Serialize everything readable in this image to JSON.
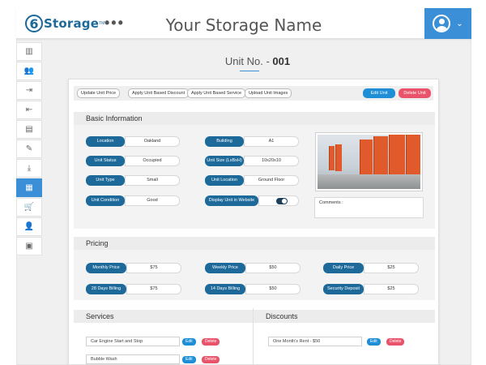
{
  "header": {
    "logo_prefix": "6",
    "logo_text": "Storage",
    "logo_tm": "TM",
    "more": "•••",
    "storage_name": "Your Storage Name",
    "accent_color": "#3a8fd6",
    "brand_color": "#1d6a9a"
  },
  "sidebar": {
    "items": [
      {
        "icon": "bar-chart-icon"
      },
      {
        "icon": "users-icon"
      },
      {
        "icon": "move-in-icon"
      },
      {
        "icon": "move-out-icon"
      },
      {
        "icon": "clipboard-icon"
      },
      {
        "icon": "edit-document-icon"
      },
      {
        "icon": "hand-money-icon"
      },
      {
        "icon": "storage-unit-icon",
        "active": true
      },
      {
        "icon": "cart-icon"
      },
      {
        "icon": "user-settings-icon"
      },
      {
        "icon": "report-icon"
      }
    ]
  },
  "page": {
    "title_prefix": "Unit No. -",
    "unit_number": "001"
  },
  "toolbar": {
    "update_price": "Update Unit Price",
    "apply_discount": "Apply Unit Based Discount",
    "apply_service": "Apply Unit Based Service",
    "upload_images": "Upload Unit Images",
    "edit_unit": "Edit Unit",
    "delete_unit": "Delete Unit"
  },
  "basic_info": {
    "heading": "Basic Information",
    "location_label": "Location",
    "location_value": "Oakland",
    "building_label": "Building",
    "building_value": "A1",
    "status_label": "Unit Status",
    "status_value": "Occupied",
    "size_label": "Unit Size (LxBxH)",
    "size_value": "10x20x10",
    "type_label": "Unit Type",
    "type_value": "Small",
    "unit_location_label": "Unit Location",
    "unit_location_value": "Ground Floor",
    "condition_label": "Unit Condition",
    "condition_value": "Good",
    "display_label": "Display Unit in Website",
    "display_on": true,
    "comments_label": "Comments :"
  },
  "pricing": {
    "heading": "Pricing",
    "monthly_label": "Monthly Price",
    "monthly_value": "$75",
    "weekly_label": "Weekly Price",
    "weekly_value": "$50",
    "daily_label": "Daily Price",
    "daily_value": "$25",
    "billing28_label": "28 Days Billing",
    "billing28_value": "$75",
    "billing14_label": "14 Days Billing",
    "billing14_value": "$50",
    "deposit_label": "Security Deposit",
    "deposit_value": "$25"
  },
  "services": {
    "heading": "Services",
    "items": [
      {
        "name": "Car Engine Start and Stop"
      },
      {
        "name": "Bubble Wash"
      }
    ],
    "edit": "Edit",
    "delete": "Delete"
  },
  "discounts": {
    "heading": "Discounts",
    "items": [
      {
        "name": "One Month's Rent - $50"
      }
    ],
    "edit": "Edit",
    "delete": "Delete"
  }
}
